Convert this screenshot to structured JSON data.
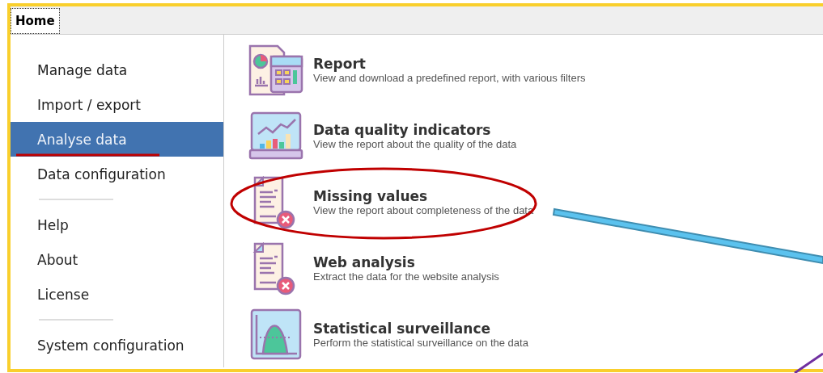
{
  "tabs": [
    {
      "label": "Home",
      "selected": true
    }
  ],
  "sidebar": {
    "groups": [
      {
        "items": [
          {
            "label": "Manage data",
            "selected": false
          },
          {
            "label": "Import / export",
            "selected": false
          },
          {
            "label": "Analyse data",
            "selected": true
          },
          {
            "label": "Data configuration",
            "selected": false
          }
        ]
      },
      {
        "items": [
          {
            "label": "Help",
            "selected": false
          },
          {
            "label": "About",
            "selected": false
          },
          {
            "label": "License",
            "selected": false
          }
        ]
      },
      {
        "items": [
          {
            "label": "System configuration",
            "selected": false
          }
        ]
      }
    ]
  },
  "actions": [
    {
      "kind": "report",
      "title": "Report",
      "description": "View and download a predefined report, with various filters"
    },
    {
      "kind": "quality",
      "title": "Data quality indicators",
      "description": "View the report about the quality of the data"
    },
    {
      "kind": "missing",
      "title": "Missing values",
      "description": "View the report about completeness of the data"
    },
    {
      "kind": "missing",
      "title": "Web analysis",
      "description": "Extract the data for the website analysis"
    },
    {
      "kind": "bell",
      "title": "Statistical surveillance",
      "description": "Perform the statistical surveillance on the data"
    }
  ]
}
